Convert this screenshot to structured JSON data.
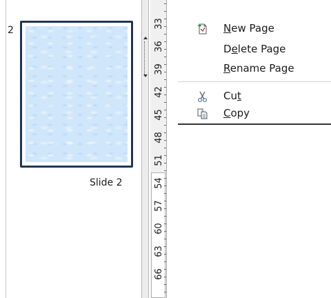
{
  "slides_panel": {
    "slide_number": "2",
    "slide_label": "Slide 2"
  },
  "ruler": {
    "labels": [
      "33",
      "36",
      "39",
      "42",
      "45",
      "48",
      "51",
      "54",
      "57",
      "60",
      "63",
      "66"
    ]
  },
  "context_menu": {
    "items": [
      {
        "pre": "",
        "key": "N",
        "post": "ew Page",
        "icon": "new-page-icon"
      },
      {
        "pre": "D",
        "key": "e",
        "post": "lete Page",
        "icon": ""
      },
      {
        "pre": "",
        "key": "R",
        "post": "ename Page",
        "icon": ""
      },
      {
        "pre": "Cu",
        "key": "t",
        "post": "",
        "icon": "scissors-icon"
      },
      {
        "pre": "",
        "key": "C",
        "post": "opy",
        "icon": "copy-icon"
      }
    ]
  }
}
